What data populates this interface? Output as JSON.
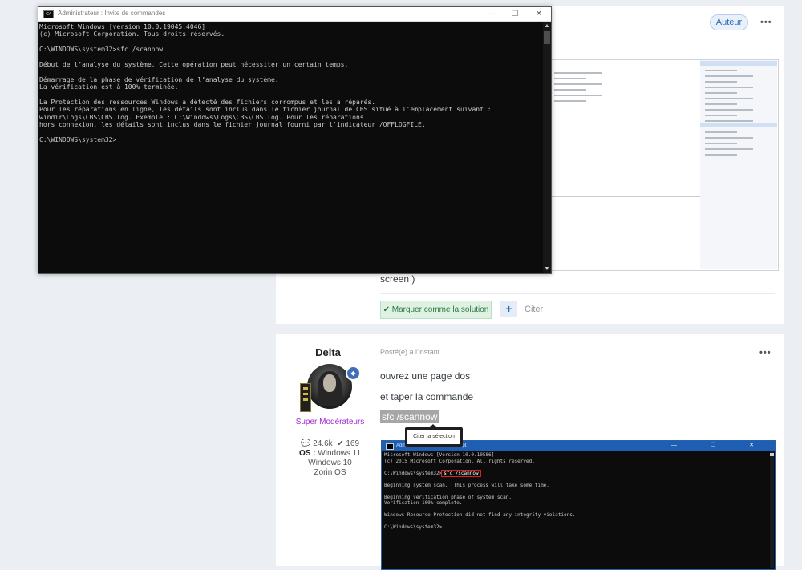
{
  "post1": {
    "author_badge": "Auteur",
    "more": "•••",
    "text_fragment": "screen )",
    "solution_label": "✔ Marquer comme la solution",
    "plus_label": "+",
    "cite_label": "Citer"
  },
  "post2": {
    "author_name": "Delta",
    "role": "Super Modérateurs",
    "posts": "24.6k",
    "reputation": "169",
    "os_label": "OS :",
    "os_lines": [
      "Windows 11",
      "Windows 10",
      "Zorin OS"
    ],
    "posted": "Posté(e) à l'instant",
    "more": "•••",
    "para1": "ouvrez une page dos",
    "para2": "et taper la commande",
    "selected_text": "sfc /scannow",
    "tooltip": "Citer la sélection",
    "cmd_title": "Administrator: Command Prompt",
    "cmd_lines": [
      "Microsoft Windows [Version 10.0.10586]",
      "(c) 2015 Microsoft Corporation. All rights reserved.",
      "",
      "C:\\Windows\\system32>",
      "",
      "Beginning system scan.  This process will take some time.",
      "",
      "Beginning verification phase of system scan.",
      "Verification 100% complete.",
      "",
      "Windows Resource Protection did not find any integrity violations.",
      "",
      "C:\\Windows\\system32>"
    ],
    "cmd_highlight": "sfc /scannow"
  },
  "console": {
    "title": "Administrateur : Invite de commandes",
    "minimize": "—",
    "maximize": "☐",
    "close": "✕",
    "lines": [
      "Microsoft Windows [version 10.0.19045.4046]",
      "(c) Microsoft Corporation. Tous droits réservés.",
      "",
      "C:\\WINDOWS\\system32>sfc /scannow",
      "",
      "Début de l’analyse du système. Cette opération peut nécessiter un certain temps.",
      "",
      "Démarrage de la phase de vérification de l’analyse du système.",
      "La vérification est à 100% terminée.",
      "",
      "La Protection des ressources Windows a détecté des fichiers corrompus et les a réparés.",
      "Pour les réparations en ligne, les détails sont inclus dans le fichier journal de CBS situé à l'emplacement suivant :",
      "windir\\Logs\\CBS\\CBS.log. Exemple : C:\\Windows\\Logs\\CBS\\CBS.log. Pour les réparations",
      "hors connexion, les détails sont inclus dans le fichier journal fourni par l'indicateur /OFFLOGFILE.",
      "",
      "C:\\WINDOWS\\system32>"
    ]
  }
}
